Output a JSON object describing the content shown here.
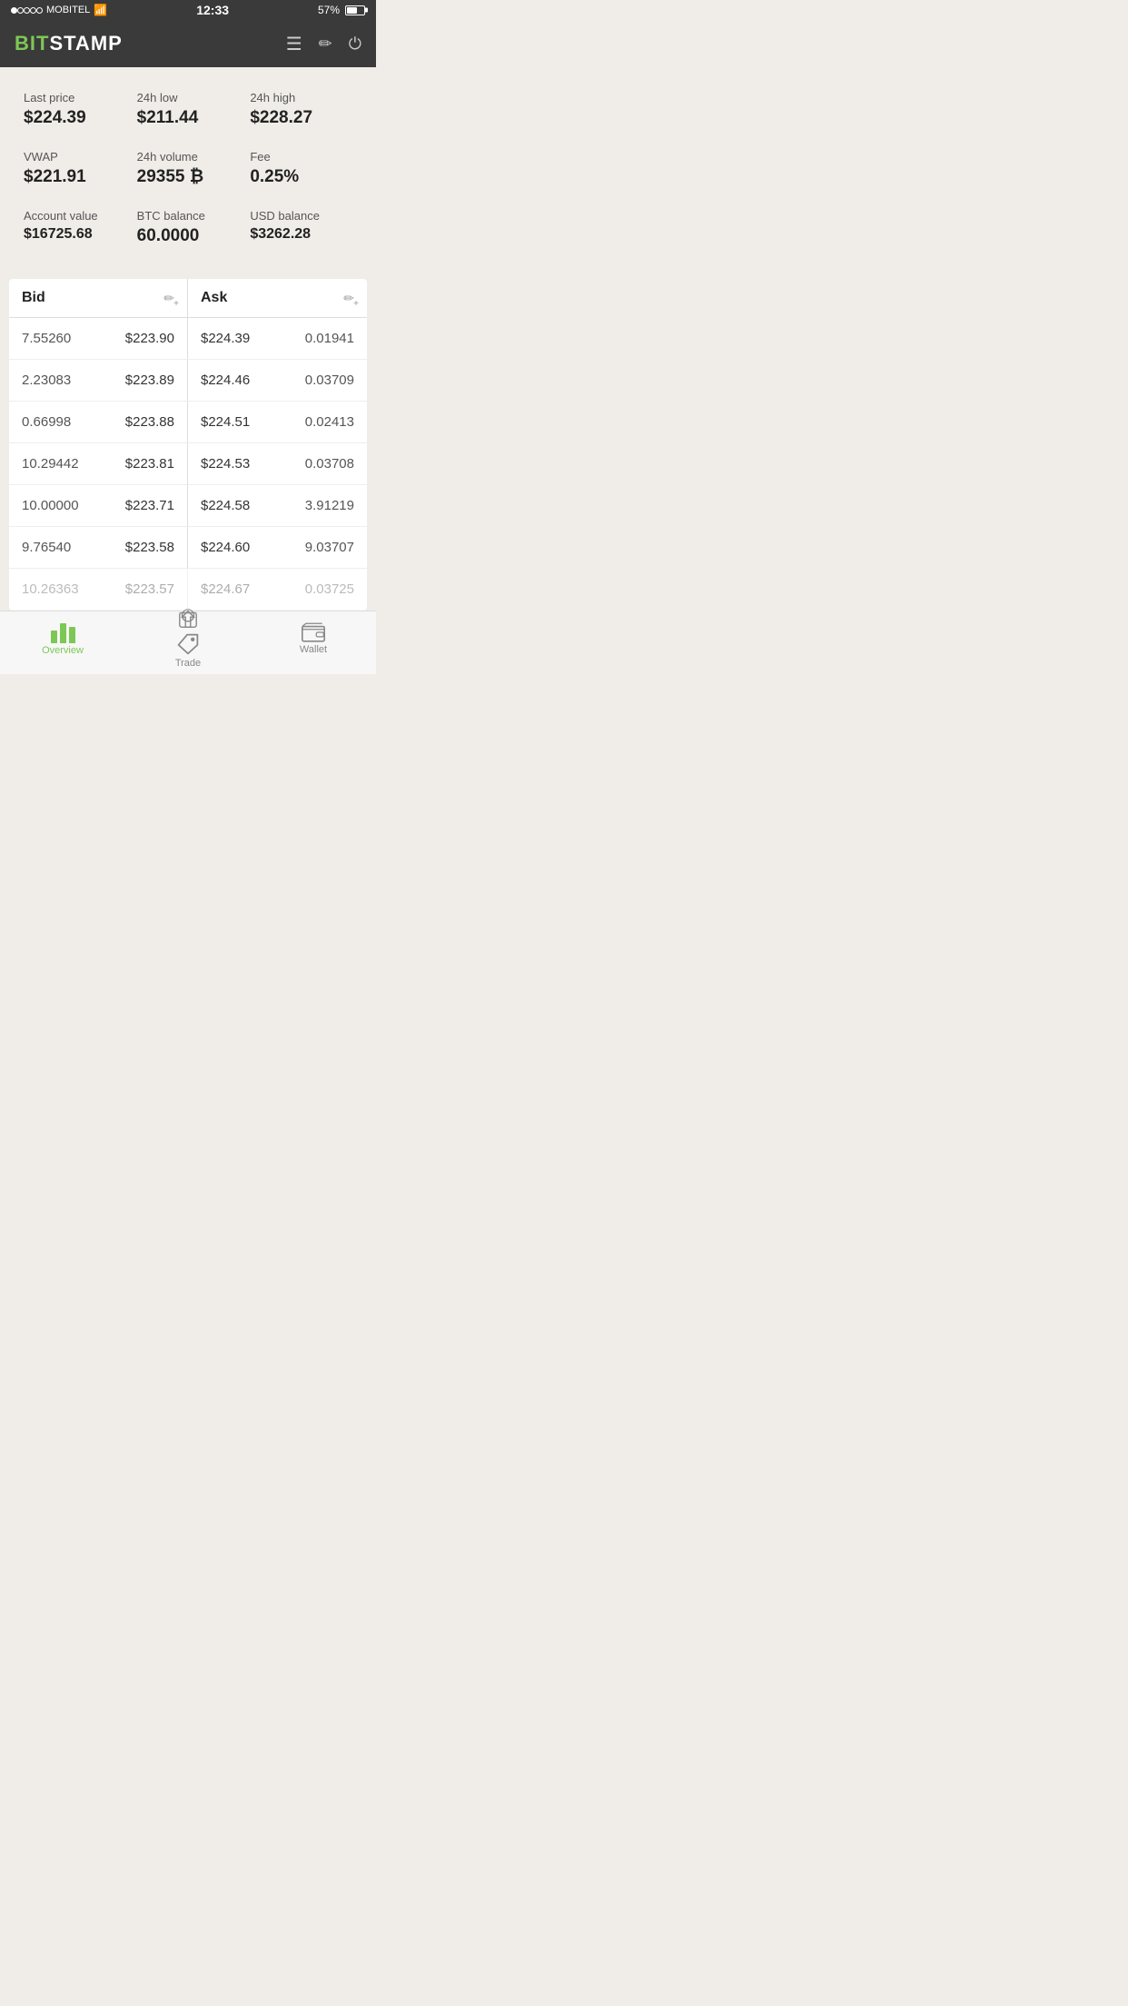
{
  "statusBar": {
    "carrier": "MOBITEL",
    "time": "12:33",
    "battery": "57%",
    "signal": "wifi"
  },
  "header": {
    "logoBit": "BIT",
    "logoStamp": "STAMP",
    "icons": [
      "menu",
      "pencil",
      "power"
    ]
  },
  "stats": [
    {
      "label": "Last price",
      "value": "$224.39"
    },
    {
      "label": "24h low",
      "value": "$211.44"
    },
    {
      "label": "24h high",
      "value": "$228.27"
    },
    {
      "label": "VWAP",
      "value": "$221.91"
    },
    {
      "label": "24h volume",
      "value": "29355 ₿"
    },
    {
      "label": "Fee",
      "value": "0.25%"
    },
    {
      "label": "Account value",
      "value": "$16725.68"
    },
    {
      "label": "BTC balance",
      "value": "60.0000"
    },
    {
      "label": "USD balance",
      "value": "$3262.28"
    }
  ],
  "orderbook": {
    "bidHeader": "Bid",
    "askHeader": "Ask",
    "rows": [
      {
        "bidAmount": "7.55260",
        "bidPrice": "$223.90",
        "askPrice": "$224.39",
        "askAmount": "0.01941"
      },
      {
        "bidAmount": "2.23083",
        "bidPrice": "$223.89",
        "askPrice": "$224.46",
        "askAmount": "0.03709"
      },
      {
        "bidAmount": "0.66998",
        "bidPrice": "$223.88",
        "askPrice": "$224.51",
        "askAmount": "0.02413"
      },
      {
        "bidAmount": "10.29442",
        "bidPrice": "$223.81",
        "askPrice": "$224.53",
        "askAmount": "0.03708"
      },
      {
        "bidAmount": "10.00000",
        "bidPrice": "$223.71",
        "askPrice": "$224.58",
        "askAmount": "3.91219"
      },
      {
        "bidAmount": "9.76540",
        "bidPrice": "$223.58",
        "askPrice": "$224.60",
        "askAmount": "9.03707"
      },
      {
        "bidAmount": "10.26363",
        "bidPrice": "$223.57",
        "askPrice": "$224.67",
        "askAmount": "0.03725"
      }
    ]
  },
  "bottomNav": [
    {
      "id": "overview",
      "label": "Overview",
      "active": true
    },
    {
      "id": "trade",
      "label": "Trade",
      "active": false
    },
    {
      "id": "wallet",
      "label": "Wallet",
      "active": false
    }
  ]
}
